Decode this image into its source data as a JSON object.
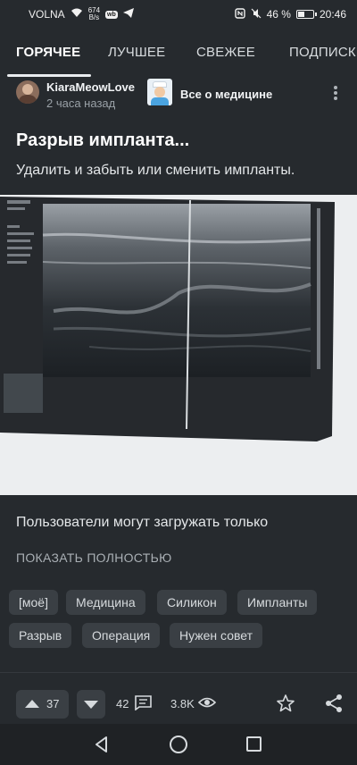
{
  "status_bar": {
    "carrier": "VOLNA",
    "speed_value": "674",
    "speed_unit": "B/s",
    "battery": "46 %",
    "time": "20:46",
    "battery_level": 0.46
  },
  "tabs": [
    "ГОРЯЧЕЕ",
    "ЛУЧШЕЕ",
    "СВЕЖЕЕ",
    "ПОДПИСКИ"
  ],
  "post": {
    "author": "KiaraMeowLove",
    "time_ago": "2 часа назад",
    "community": "Все о медицине",
    "title": "Разрыв импланта...",
    "subtitle": "Удалить и забыть или сменить импланты.",
    "body": "Пользователи могут загружать только",
    "show_more": "ПОКАЗАТЬ ПОЛНОСТЬЮ",
    "tags": [
      "[моё]",
      "Медицина",
      "Силикон",
      "Импланты",
      "Разрыв",
      "Операция",
      "Нужен совет"
    ],
    "upvotes": "37",
    "comments": "42",
    "views": "3.8K"
  },
  "colors": {
    "background": "#262a2e",
    "chip": "#3a3f44",
    "nav_bar": "#1f2225"
  }
}
